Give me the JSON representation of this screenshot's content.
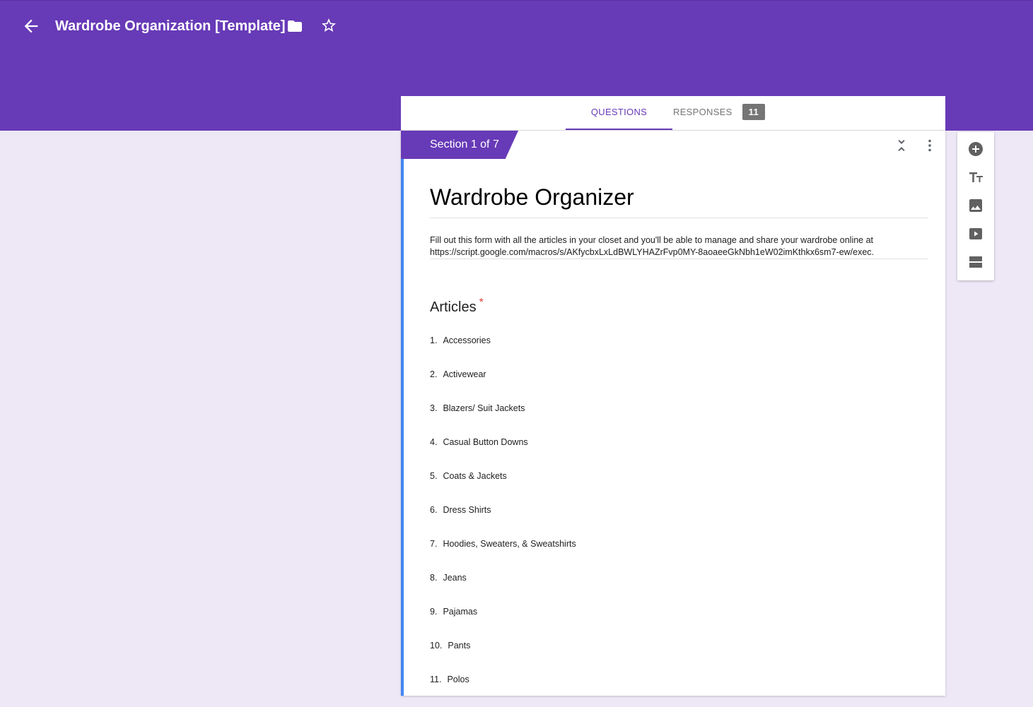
{
  "colors": {
    "accent": "#673ab7",
    "background": "#ede7f6",
    "focus_bar": "#4285f4",
    "required": "#db4437"
  },
  "header": {
    "title": "Wardrobe Organization [Template]",
    "icons": {
      "back": "arrow-back-icon",
      "folder": "folder-icon",
      "star": "star-outline-icon"
    }
  },
  "tabs": {
    "questions": "QUESTIONS",
    "responses": "RESPONSES",
    "responses_count": "11"
  },
  "section": {
    "label": "Section 1 of 7",
    "icons": {
      "collapse": "collapse-icon",
      "more": "more-vert-icon"
    }
  },
  "form": {
    "title": "Wardrobe Organizer",
    "description_line1": "Fill out this form with all the articles in your closet and you'll be able to manage and share your wardrobe online at",
    "description_line2": "https://script.google.com/macros/s/AKfycbxLxLdBWLYHAZrFvp0MY-8aoaeeGkNbh1eW02imKthkx6sm7-ew/exec."
  },
  "question": {
    "title": "Articles",
    "required_mark": "*",
    "options": [
      {
        "num": "1.",
        "label": "Accessories"
      },
      {
        "num": "2.",
        "label": "Activewear"
      },
      {
        "num": "3.",
        "label": "Blazers/ Suit Jackets"
      },
      {
        "num": "4.",
        "label": "Casual Button Downs"
      },
      {
        "num": "5.",
        "label": "Coats & Jackets"
      },
      {
        "num": "6.",
        "label": "Dress Shirts"
      },
      {
        "num": "7.",
        "label": "Hoodies, Sweaters, & Sweatshirts"
      },
      {
        "num": "8.",
        "label": "Jeans"
      },
      {
        "num": "9.",
        "label": "Pajamas"
      },
      {
        "num": "10.",
        "label": "Pants"
      },
      {
        "num": "11.",
        "label": "Polos"
      }
    ]
  },
  "toolbar": {
    "icons": [
      "add-circle-icon",
      "title-text-icon",
      "image-icon",
      "video-icon",
      "section-icon"
    ]
  }
}
